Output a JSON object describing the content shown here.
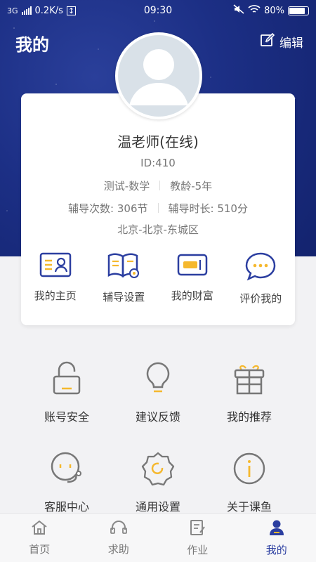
{
  "status_bar": {
    "network": "3G",
    "speed": "0.2K/s",
    "time": "09:30",
    "battery": "80%"
  },
  "header": {
    "title": "我的",
    "edit_label": "编辑"
  },
  "profile": {
    "name": "温老师(在线)",
    "id": "ID:410",
    "subject": "测试-数学",
    "teaching_age": "教龄-5年",
    "sessions": "辅导次数: 306节",
    "duration": "辅导时长: 510分",
    "location": "北京-北京-东城区"
  },
  "card_actions": [
    {
      "label": "我的主页",
      "icon": "id-card-icon"
    },
    {
      "label": "辅导设置",
      "icon": "book-gear-icon"
    },
    {
      "label": "我的财富",
      "icon": "wallet-icon"
    },
    {
      "label": "评价我的",
      "icon": "chat-bubble-icon"
    }
  ],
  "menu": [
    {
      "label": "账号安全",
      "icon": "lock-icon"
    },
    {
      "label": "建议反馈",
      "icon": "lightbulb-icon"
    },
    {
      "label": "我的推荐",
      "icon": "gift-icon"
    },
    {
      "label": "客服中心",
      "icon": "headset-icon"
    },
    {
      "label": "通用设置",
      "icon": "settings-icon"
    },
    {
      "label": "关于课鱼",
      "icon": "info-icon"
    }
  ],
  "tabs": [
    {
      "label": "首页",
      "icon": "home-icon"
    },
    {
      "label": "求助",
      "icon": "headset-icon"
    },
    {
      "label": "作业",
      "icon": "homework-icon"
    },
    {
      "label": "我的",
      "icon": "person-icon",
      "active": true
    }
  ],
  "colors": {
    "brand": "#2b3ea0",
    "accent": "#f5b82e",
    "header_bg": "#1c2f85"
  }
}
